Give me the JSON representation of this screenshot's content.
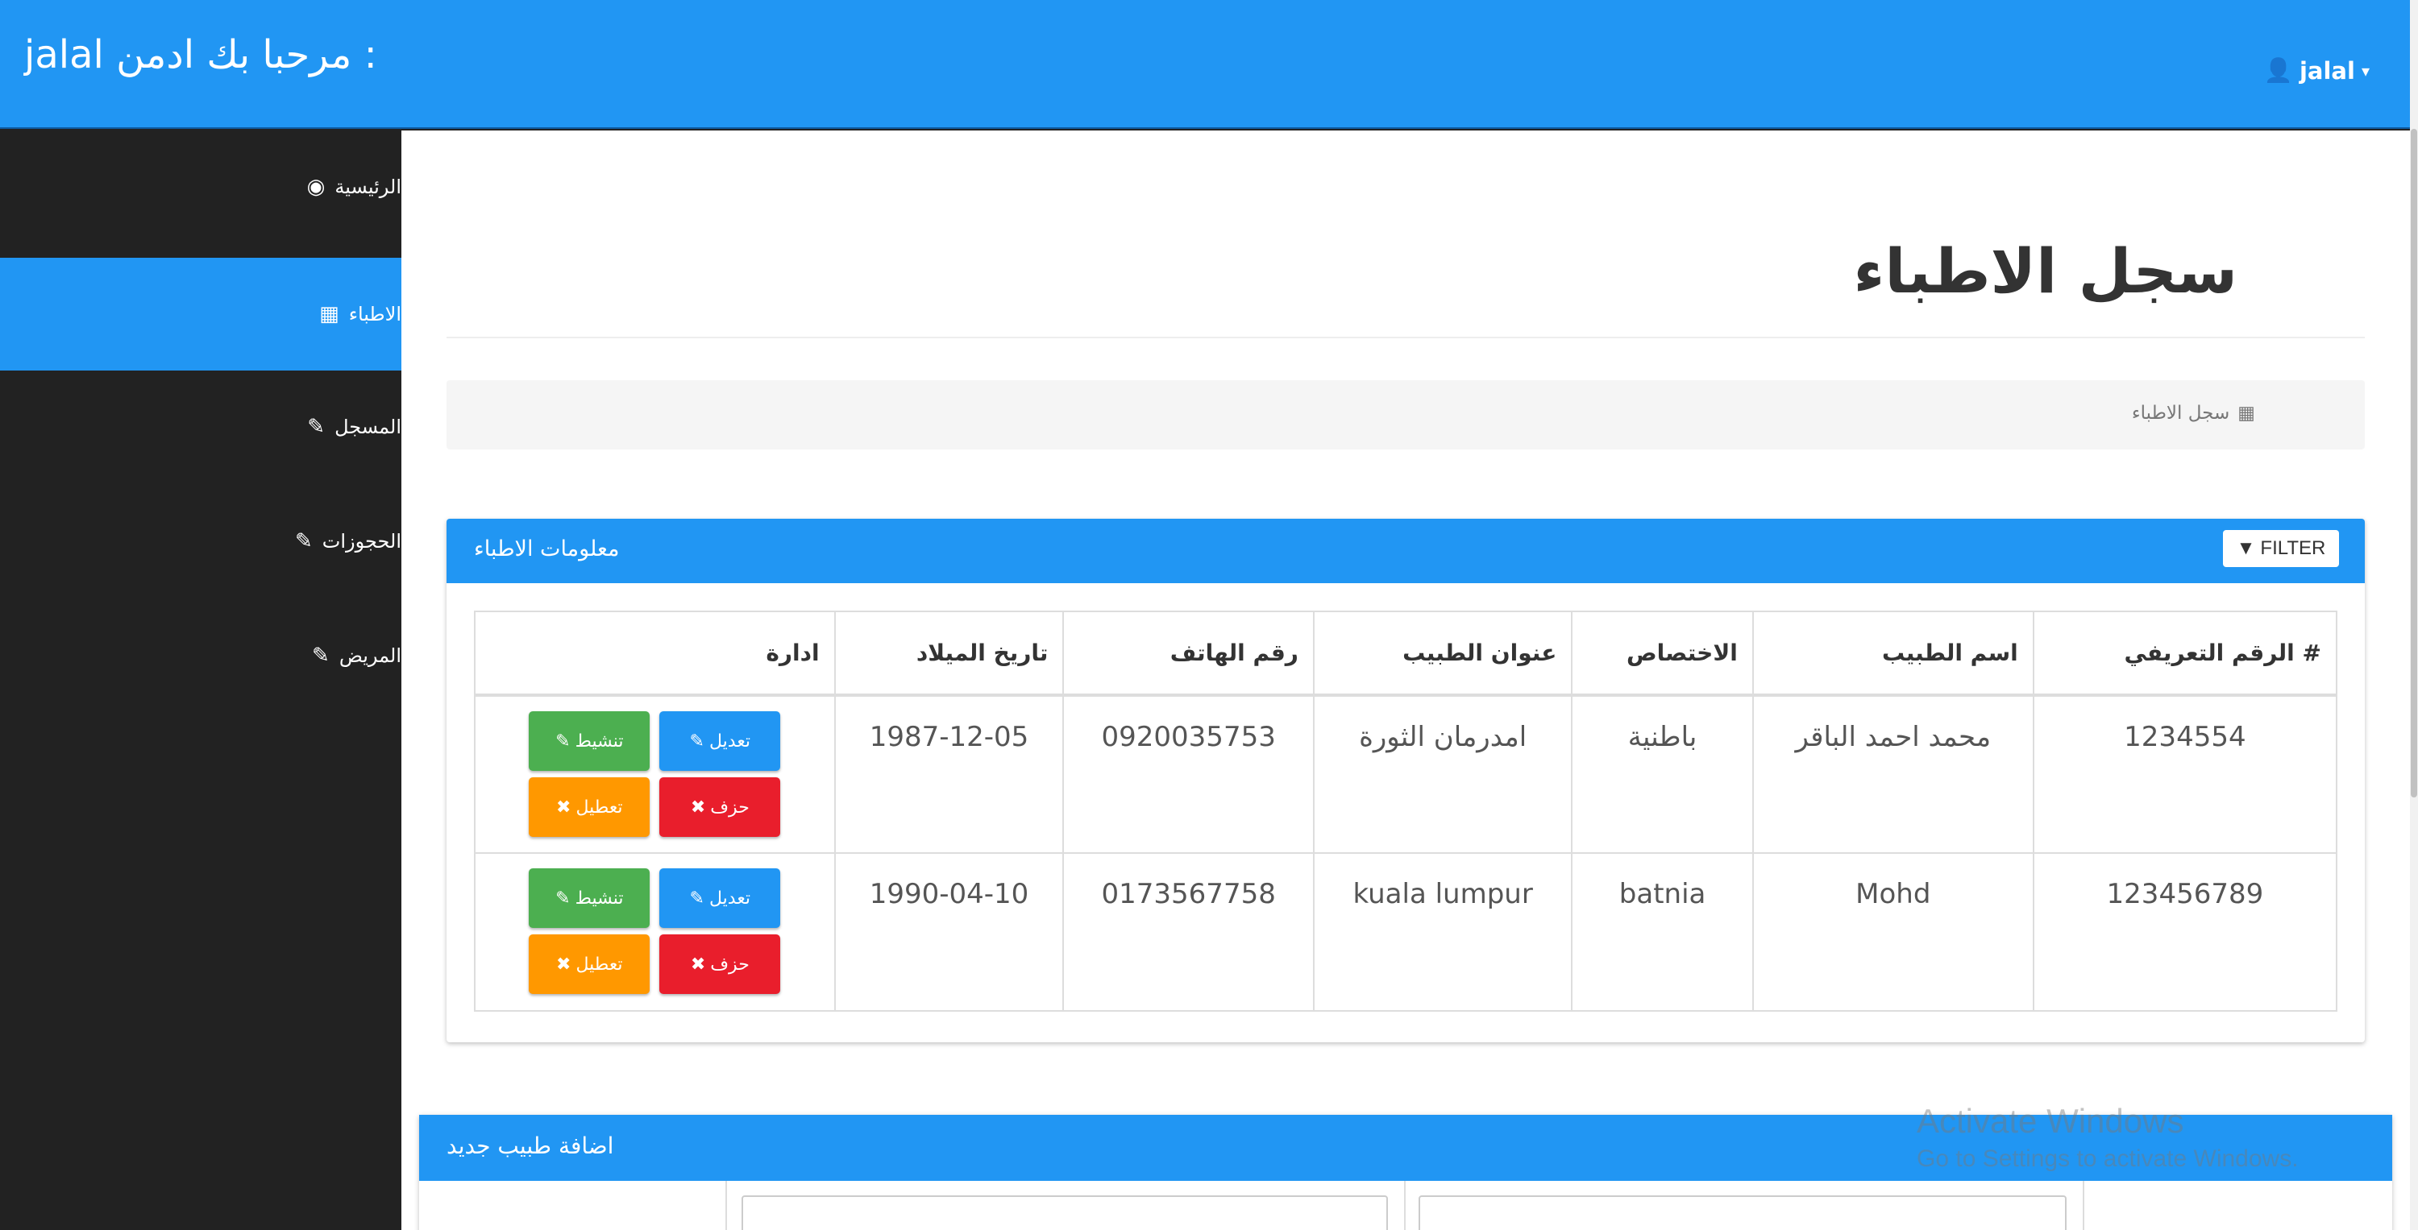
{
  "header": {
    "brand_user": "jalal",
    "brand_greeting": "مرحبا بك ادمن :",
    "user_menu": "jalal"
  },
  "sidebar": {
    "items": [
      {
        "label": "الرئيسية",
        "icon": "dashboard-icon"
      },
      {
        "label": "الاطباء",
        "icon": "table-icon",
        "active": true
      },
      {
        "label": "المسجل",
        "icon": "edit-icon"
      },
      {
        "label": "الحجوزات",
        "icon": "edit-icon"
      },
      {
        "label": "المريض",
        "icon": "edit-icon"
      }
    ]
  },
  "page": {
    "title": "سجل الاطباء",
    "breadcrumb": "سجل الاطباء"
  },
  "doctors_panel": {
    "title": "معلومات الاطباء",
    "filter_label": "FILTER",
    "columns": [
      "# الرقم التعريفي",
      "اسم الطبيب",
      "الاختصاص",
      "عنوان الطبيب",
      "رقم الهاتف",
      "تاريخ الميلاد",
      "ادارة"
    ],
    "rows": [
      {
        "id": "1234554",
        "name": "محمد احمد الباقر",
        "specialty": "باطنية",
        "address": "امدرمان الثورة",
        "phone": "0920035753",
        "dob": "1987-12-05"
      },
      {
        "id": "123456789",
        "name": "Mohd",
        "specialty": "batnia",
        "address": "kuala lumpur",
        "phone": "0173567758",
        "dob": "1990-04-10"
      }
    ],
    "actions": {
      "edit": "تعديل",
      "activate": "تنشيط",
      "delete": "حزف",
      "disable": "تعطيل"
    }
  },
  "add_panel": {
    "title": "اضافة طبيب جديد"
  },
  "watermark": {
    "line1": "Activate Windows",
    "line2": "Go to Settings to activate Windows."
  },
  "colors": {
    "primary": "#2196f3",
    "sidebar": "#222222",
    "success": "#4caf50",
    "danger": "#e91e2c",
    "warning": "#ff9800"
  }
}
